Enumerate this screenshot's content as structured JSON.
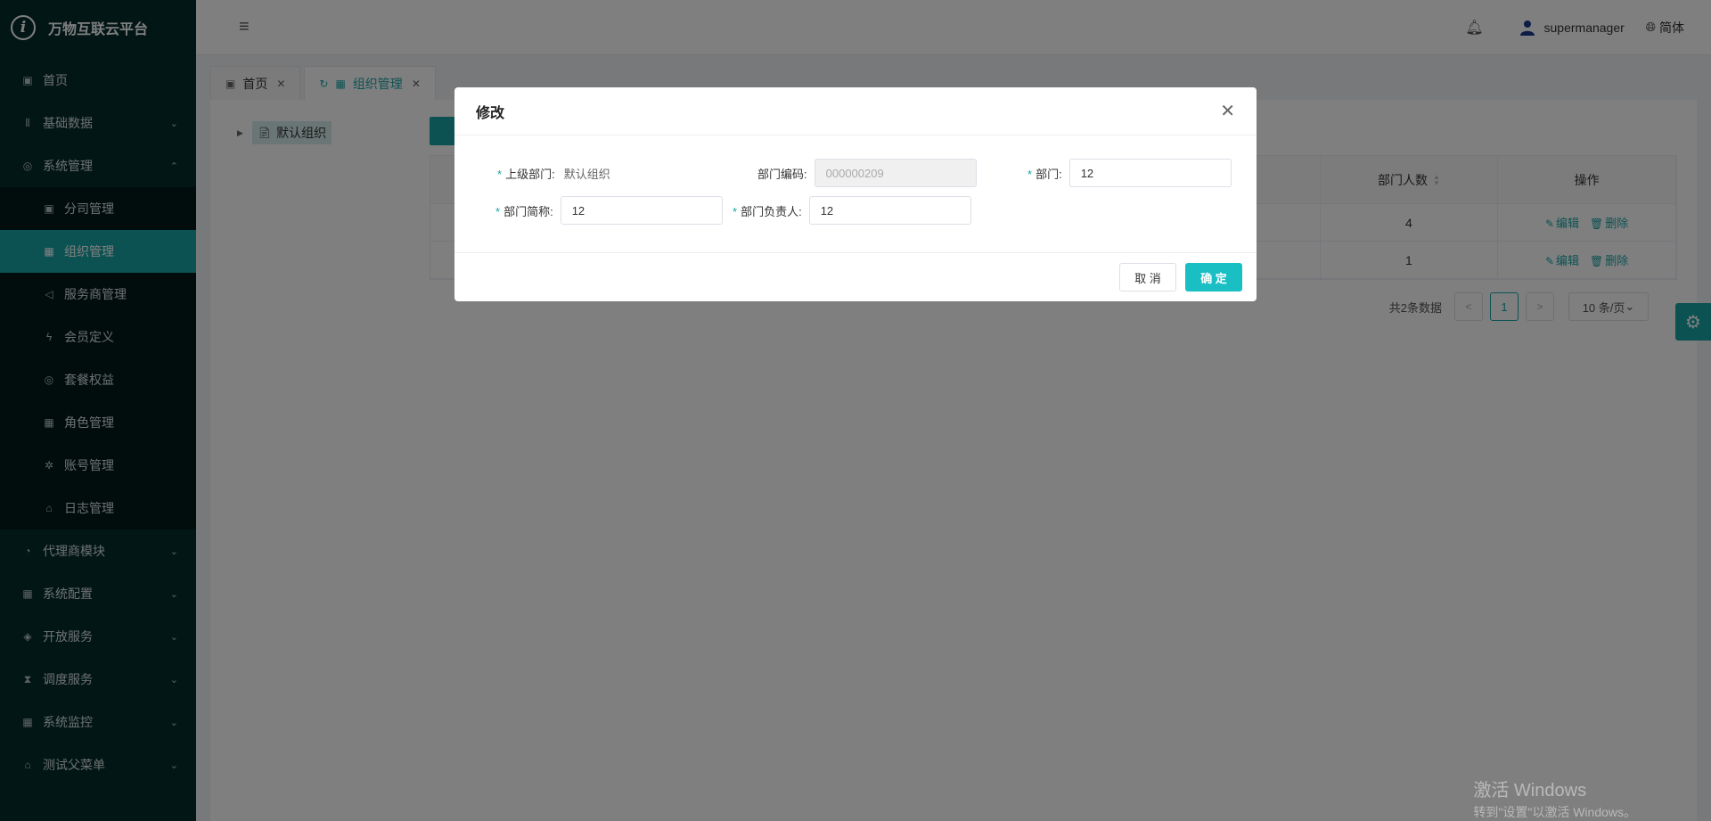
{
  "app": {
    "title": "万物互联云平台",
    "logo_glyph": "i"
  },
  "sidebar": {
    "items": [
      {
        "label": "首页",
        "icon": "calendar-icon",
        "glyph": "▣"
      },
      {
        "label": "基础数据",
        "icon": "barcode-icon",
        "glyph": "⦀"
      },
      {
        "label": "系统管理",
        "icon": "camera-icon",
        "glyph": "◎",
        "expanded": true
      }
    ],
    "subitems": [
      {
        "label": "分司管理",
        "icon": "calendar-icon",
        "glyph": "▣"
      },
      {
        "label": "组织管理",
        "icon": "grid-icon",
        "glyph": "▦",
        "active": true
      },
      {
        "label": "服务商管理",
        "icon": "speaker-icon",
        "glyph": "◁"
      },
      {
        "label": "会员定义",
        "icon": "lightning-icon",
        "glyph": "ϟ"
      },
      {
        "label": "套餐权益",
        "icon": "camera-icon",
        "glyph": "◎"
      },
      {
        "label": "角色管理",
        "icon": "grid-icon",
        "glyph": "▦"
      },
      {
        "label": "账号管理",
        "icon": "bug-icon",
        "glyph": "✲"
      },
      {
        "label": "日志管理",
        "icon": "home-icon",
        "glyph": "⌂"
      }
    ],
    "bottom_items": [
      {
        "label": "代理商模块",
        "icon": "bell-icon",
        "glyph": "◔"
      },
      {
        "label": "系统配置",
        "icon": "grid-icon",
        "glyph": "▦"
      },
      {
        "label": "开放服务",
        "icon": "tag-icon",
        "glyph": "◈"
      },
      {
        "label": "调度服务",
        "icon": "hourglass-icon",
        "glyph": "⧗"
      },
      {
        "label": "系统监控",
        "icon": "grid-icon",
        "glyph": "▦"
      },
      {
        "label": "测试父菜单",
        "icon": "bank-icon",
        "glyph": "⌂"
      }
    ]
  },
  "header": {
    "username": "supermanager",
    "language": "简体"
  },
  "tabs": [
    {
      "label": "首页",
      "active": false
    },
    {
      "label": "组织管理",
      "active": true
    }
  ],
  "tree": {
    "root_label": "默认组织"
  },
  "table": {
    "columns": [
      "部门人数",
      "操作"
    ],
    "rows": [
      {
        "count": "4",
        "edit": "编辑",
        "delete": "删除"
      },
      {
        "count": "1",
        "edit": "编辑",
        "delete": "删除"
      }
    ]
  },
  "pagination": {
    "total": "共2条数据",
    "current_page": "1",
    "page_size": "10 条/页"
  },
  "modal": {
    "title": "修改",
    "fields": {
      "parent_dept": {
        "label": "上级部门:",
        "value": "默认组织"
      },
      "dept_code": {
        "label": "部门编码:",
        "value": "000000209"
      },
      "dept": {
        "label": "部门:",
        "value": "12"
      },
      "dept_short": {
        "label": "部门简称:",
        "value": "12"
      },
      "dept_head": {
        "label": "部门负责人:",
        "value": "12"
      }
    },
    "cancel_label": "取 消",
    "ok_label": "确 定"
  },
  "watermark": {
    "line1": "激活 Windows",
    "line2": "转到\"设置\"以激活 Windows。"
  },
  "colors": {
    "accent": "#1aa4a7",
    "sidebar_bg": "#062d2d",
    "primary_button": "#1abfc4"
  }
}
